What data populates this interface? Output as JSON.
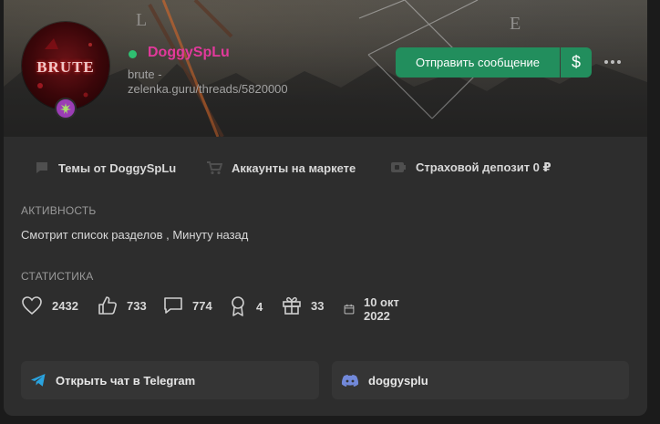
{
  "profile": {
    "username": "DoggySpLu",
    "title": "brute - zelenka.guru/threads/5820000",
    "avatar_text": "BRUTE",
    "online": true,
    "username_color": "#e2399b",
    "badge_color": "#9b3db5"
  },
  "actions": {
    "send_message": "Отправить сообщение",
    "money_icon": "dollar-icon",
    "more_icon": "more-horizontal-icon",
    "accent": "#228e5d"
  },
  "links": {
    "threads": "Темы от DoggySpLu",
    "market": "Аккаунты на маркете",
    "deposit": "Страховой депозит 0 ₽"
  },
  "activity": {
    "label": "АКТИВНОСТЬ",
    "text": "Смотрит список разделов , Минуту назад"
  },
  "stats": {
    "label": "СТАТИСТИКА",
    "likes": "2432",
    "thumbs": "733",
    "messages": "774",
    "trophies": "4",
    "gifts": "33",
    "registered": "10 окт 2022"
  },
  "social": {
    "telegram": "Открыть чат в Telegram",
    "discord": "doggysplu",
    "telegram_color": "#2aa3df",
    "discord_color": "#7289da"
  }
}
